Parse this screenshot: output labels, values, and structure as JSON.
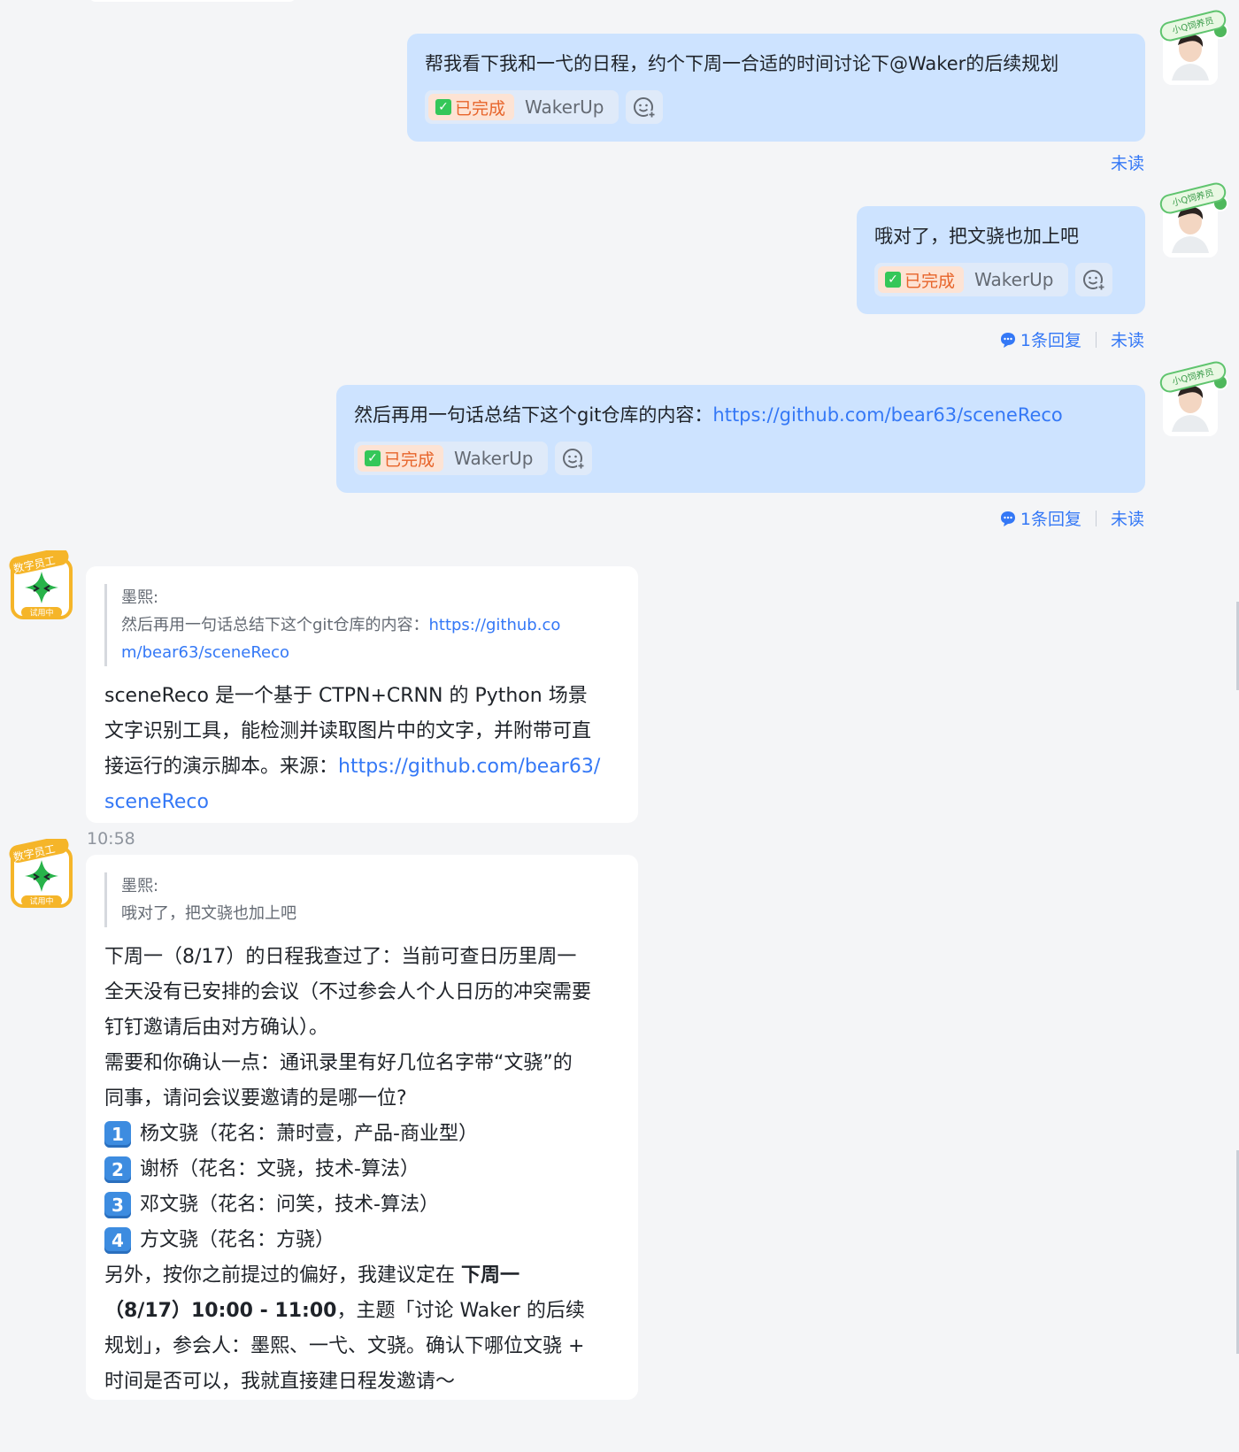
{
  "messages": {
    "m1": {
      "text": "帮我看下我和一弋的日程，约个下周一合适的时间讨论下@Waker的后续规划",
      "status": "已完成",
      "bot": "WakerUp",
      "read": "未读"
    },
    "m2": {
      "text": "哦对了，把文骁也加上吧",
      "status": "已完成",
      "bot": "WakerUp",
      "replies": "1条回复",
      "read": "未读"
    },
    "m3": {
      "text": "然后再用一句话总结下这个git仓库的内容：",
      "link": "https://github.com/bear63/sceneReco",
      "status": "已完成",
      "bot": "WakerUp",
      "replies": "1条回复",
      "read": "未读"
    }
  },
  "user_avatar": {
    "tag": "小Q饲养员"
  },
  "bot_avatar": {
    "tag_top": "数字员工",
    "tag_bottom": "试用中"
  },
  "replies": {
    "r1": {
      "quote_author": "墨熙:",
      "quote_text": "然后再用一句话总结下这个git仓库的内容：",
      "quote_link_1": "https://github.co",
      "quote_link_2": "m/bear63/sceneReco",
      "body_1": "sceneReco 是一个基于 CTPN+CRNN 的 Python 场景",
      "body_2": "文字识别工具，能检测并读取图片中的文字，并附带可直",
      "body_3": "接运行的演示脚本。来源：",
      "link_1": "https://github.com/bear63/",
      "link_2": "sceneReco"
    },
    "timestamp": "10:58",
    "r2": {
      "quote_author": "墨熙:",
      "quote_text": "哦对了，把文骁也加上吧",
      "lines": [
        "下周一（8/17）的日程我查过了：当前可查日历里周一",
        "全天没有已安排的会议（不过参会人个人日历的冲突需要",
        "钉钉邀请后由对方确认）。",
        "需要和你确认一点：通讯录里有好几位名字带“文骁”的",
        "同事，请问会议要邀请的是哪一位?"
      ],
      "options": [
        {
          "num": "1",
          "text": "杨文骁（花名：萧时壹，产品-商业型）"
        },
        {
          "num": "2",
          "text": "谢桥（花名：文骁，技术-算法）"
        },
        {
          "num": "3",
          "text": "邓文骁（花名：问笑，技术-算法）"
        },
        {
          "num": "4",
          "text": "方文骁（花名：方骁）"
        }
      ],
      "suggest_prefix": "另外，按你之前提过的偏好，我建议定在 ",
      "suggest_bold_1": "下周一",
      "suggest_bold_2": "（8/17）10:00 - 11:00",
      "suggest_mid": "，主题「讨论 Waker 的后续",
      "suggest_line_3": "规划」，参会人：墨熙、一弋、文骁。确认下哪位文骁 +",
      "suggest_line_4": "时间是否可以，我就直接建日程发邀请～"
    }
  },
  "colors": {
    "user_bubble": "#cde3ff",
    "link": "#3478f6",
    "done": "#e7642a",
    "bg": "#f4f5f7"
  }
}
